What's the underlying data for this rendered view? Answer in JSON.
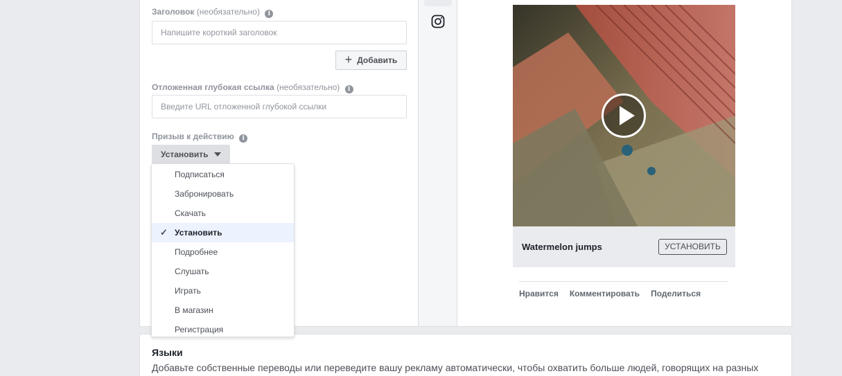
{
  "form": {
    "headline": {
      "label": "Заголовок",
      "optional": "(необязательно)",
      "placeholder": "Напишите короткий заголовок"
    },
    "add_button_label": "Добавить",
    "deep_link": {
      "label": "Отложенная глубокая ссылка",
      "optional": "(необязательно)",
      "placeholder": "Введите URL отложенной глубокой ссылки"
    },
    "cta": {
      "label": "Призыв к действию",
      "selected": "Установить",
      "options": [
        "Подписаться",
        "Забронировать",
        "Скачать",
        "Установить",
        "Подробнее",
        "Слушать",
        "Играть",
        "В магазин",
        "Регистрация"
      ]
    }
  },
  "placements": {
    "icons": [
      "instagram-icon"
    ]
  },
  "preview": {
    "app_name": "Watermelon jumps",
    "install_label": "УСТАНОВИТЬ",
    "actions": [
      "Нравится",
      "Комментировать",
      "Поделиться"
    ]
  },
  "languages": {
    "title": "Языки",
    "description": "Добавьте собственные переводы или переведите вашу рекламу автоматически, чтобы охватить больше людей, говорящих на разных"
  },
  "colors": {
    "background": "#e9ebee",
    "selected_row": "#ecf3ff",
    "muted_text": "#90949c"
  }
}
